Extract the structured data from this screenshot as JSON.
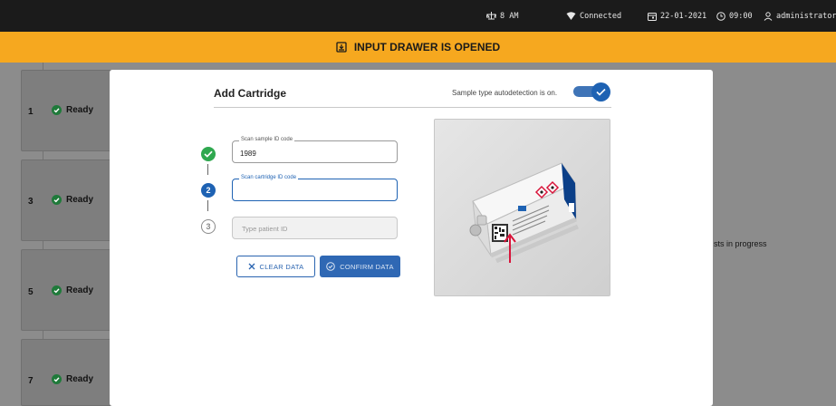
{
  "status_bar": {
    "drawer_time": "8 AM",
    "connection": "Connected",
    "date": "22-01-2021",
    "time": "09:00",
    "user": "administrator"
  },
  "banner": {
    "text": "INPUT DRAWER IS OPENED"
  },
  "slots": [
    {
      "number": "1",
      "status": "Ready"
    },
    {
      "number": "3",
      "status": "Ready"
    },
    {
      "number": "5",
      "status": "Ready"
    },
    {
      "number": "7",
      "status": "Ready"
    }
  ],
  "background": {
    "partial_text": "sts in progress"
  },
  "modal": {
    "title": "Add Cartridge",
    "autodetect_text": "Sample type autodetection is on.",
    "autodetect_on": true,
    "steps": [
      {
        "index": "1",
        "state": "done",
        "legend": "Scan sample ID code",
        "value": "1989"
      },
      {
        "index": "2",
        "state": "active",
        "legend": "Scan cartridge ID code",
        "value": ""
      },
      {
        "index": "3",
        "state": "pending",
        "placeholder": "Type patient ID"
      }
    ],
    "clear_label": "CLEAR DATA",
    "confirm_label": "CONFIRM DATA"
  },
  "colors": {
    "accent": "#1e62b3",
    "success": "#2fa84f",
    "banner": "#f6a81f",
    "topbar": "#1b1b1b",
    "arrow": "#d8143a"
  },
  "icons": [
    "scale-icon",
    "heart-wifi-icon",
    "calendar-icon",
    "clock-icon",
    "user-icon",
    "drawer-icon",
    "check-circle-icon",
    "close-icon",
    "check-outline-icon"
  ]
}
